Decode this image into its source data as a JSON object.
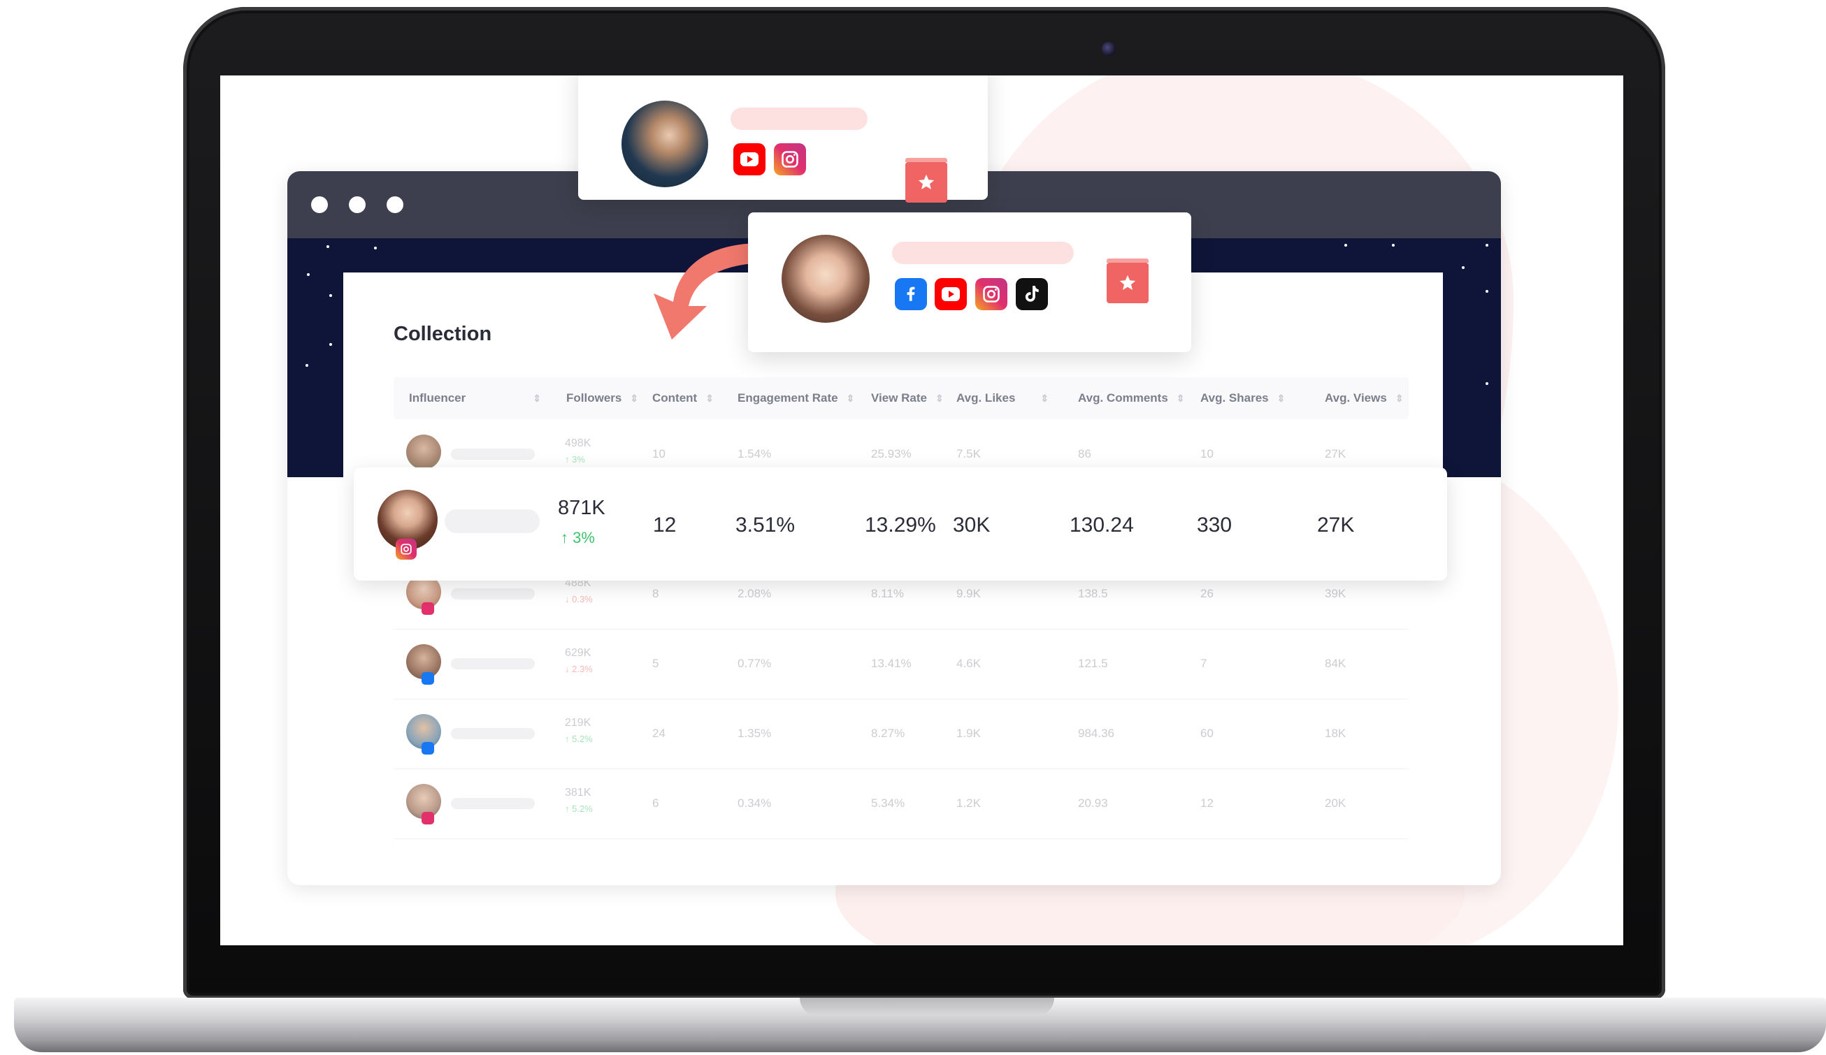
{
  "collection": {
    "title": "Collection",
    "columns": [
      "Influencer",
      "Followers",
      "Content",
      "Engagement Rate",
      "View Rate",
      "Avg. Likes",
      "Avg. Comments",
      "Avg. Shares",
      "Avg. Views"
    ],
    "rows": [
      {
        "followers": "498K",
        "change": "↑ 3%",
        "content": "10",
        "engagement": "1.54%",
        "view_rate": "25.93%",
        "likes": "7.5K",
        "comments": "86",
        "shares": "10",
        "views": "27K",
        "badge_color": "#3cc36b"
      },
      {
        "followers": "488K",
        "change": "↓ 0.3%",
        "content": "8",
        "engagement": "2.08%",
        "view_rate": "8.11%",
        "likes": "9.9K",
        "comments": "138.5",
        "shares": "26",
        "views": "39K",
        "badge_color": "#e1306c"
      },
      {
        "followers": "629K",
        "change": "↓ 2.3%",
        "content": "5",
        "engagement": "0.77%",
        "view_rate": "13.41%",
        "likes": "4.6K",
        "comments": "121.5",
        "shares": "7",
        "views": "84K",
        "badge_color": "#1877f2"
      },
      {
        "followers": "219K",
        "change": "↑ 5.2%",
        "content": "24",
        "engagement": "1.35%",
        "view_rate": "8.27%",
        "likes": "1.9K",
        "comments": "984.36",
        "shares": "60",
        "views": "18K",
        "badge_color": "#1877f2"
      },
      {
        "followers": "381K",
        "change": "↑ 5.2%",
        "content": "6",
        "engagement": "0.34%",
        "view_rate": "5.34%",
        "likes": "1.2K",
        "comments": "20.93",
        "shares": "12",
        "views": "20K",
        "badge_color": "#e1306c"
      }
    ],
    "highlight": {
      "followers": "871K",
      "change": "↑ 3%",
      "content": "12",
      "engagement": "3.51%",
      "view_rate": "13.29%",
      "likes": "30K",
      "comments": "130.24",
      "shares": "330",
      "views": "27K"
    }
  },
  "cards": [
    {
      "platforms": [
        "youtube-icon",
        "instagram-icon"
      ]
    },
    {
      "platforms": [
        "facebook-icon",
        "youtube-icon",
        "instagram-icon",
        "tiktok-icon"
      ]
    }
  ],
  "colors": {
    "accent": "#f06464",
    "positive": "#3cc36b",
    "negative": "#f06464",
    "starfield": "#0e1538",
    "titlebar": "#3d3f4e"
  }
}
